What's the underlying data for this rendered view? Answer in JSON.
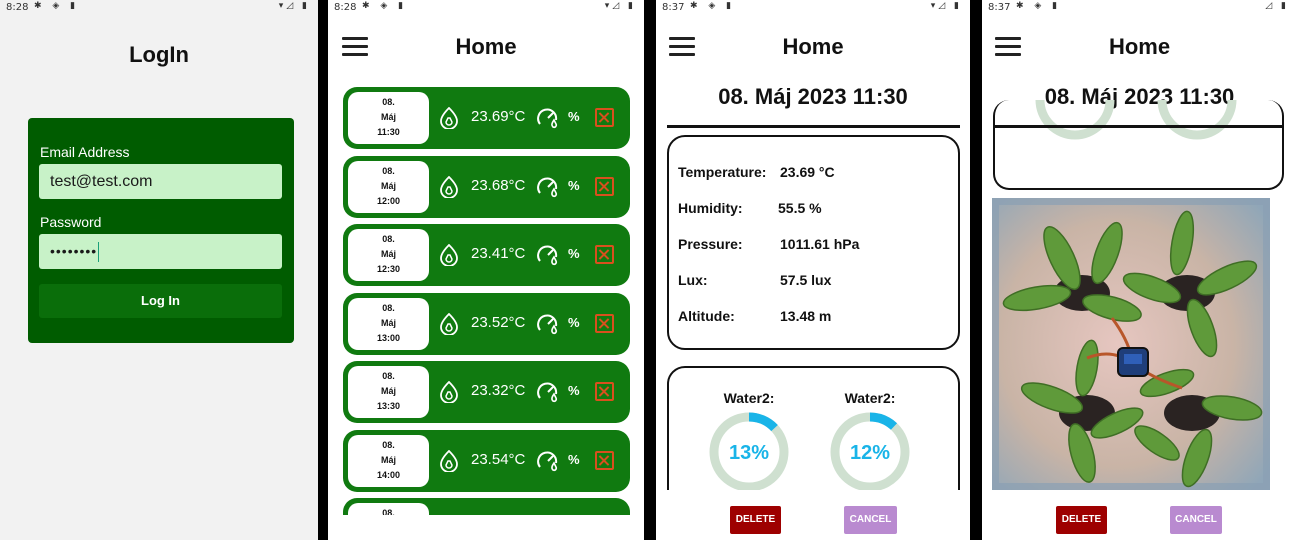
{
  "colors": {
    "primary_green": "#005c00",
    "row_green": "#107a10",
    "field_green": "#c8f2c8",
    "delete_red": "#9e0000",
    "cancel_purple": "#b98ad0",
    "ring_blue": "#19b4e8",
    "ring_track": "#cfe0d0"
  },
  "login": {
    "status_time": "8:28",
    "title": "LogIn",
    "email_label": "Email Address",
    "email_value": "test@test.com",
    "password_label": "Password",
    "password_value": "••••••••",
    "login_button": "Log In"
  },
  "list": {
    "status_time": "8:28",
    "title": "Home",
    "menu_icon": "hamburger-menu-icon",
    "pct_symbol": "%",
    "entries": [
      {
        "day": "08.",
        "month": "Máj",
        "time": "11:30",
        "temp": "23.69°C"
      },
      {
        "day": "08.",
        "month": "Máj",
        "time": "12:00",
        "temp": "23.68°C"
      },
      {
        "day": "08.",
        "month": "Máj",
        "time": "12:30",
        "temp": "23.41°C"
      },
      {
        "day": "08.",
        "month": "Máj",
        "time": "13:00",
        "temp": "23.52°C"
      },
      {
        "day": "08.",
        "month": "Máj",
        "time": "13:30",
        "temp": "23.32°C"
      },
      {
        "day": "08.",
        "month": "Máj",
        "time": "14:00",
        "temp": "23.54°C"
      },
      {
        "day": "08.",
        "month": "",
        "time": "",
        "temp": ""
      }
    ]
  },
  "detail": {
    "status_time": "8:37",
    "title": "Home",
    "datetime": "08. Máj 2023 11:30",
    "readings": [
      {
        "label": "Temperature:",
        "value": "23.69 °C"
      },
      {
        "label": "Humidity:",
        "value": "55.5  %"
      },
      {
        "label": "Pressure:",
        "value": "1011.61 hPa"
      },
      {
        "label": "Lux:",
        "value": "57.5 lux"
      },
      {
        "label": "Altitude:",
        "value": "13.48 m"
      }
    ],
    "water": [
      {
        "label": "Water2:",
        "percent_text": "13%",
        "percent": 13
      },
      {
        "label": "Water2:",
        "percent_text": "12%",
        "percent": 12
      }
    ],
    "delete_button": "DELETE",
    "cancel_button": "CANCEL"
  },
  "photo_view": {
    "status_time": "8:37",
    "title": "Home",
    "datetime": "08. Máj 2023 11:30",
    "delete_button": "DELETE",
    "cancel_button": "CANCEL"
  }
}
